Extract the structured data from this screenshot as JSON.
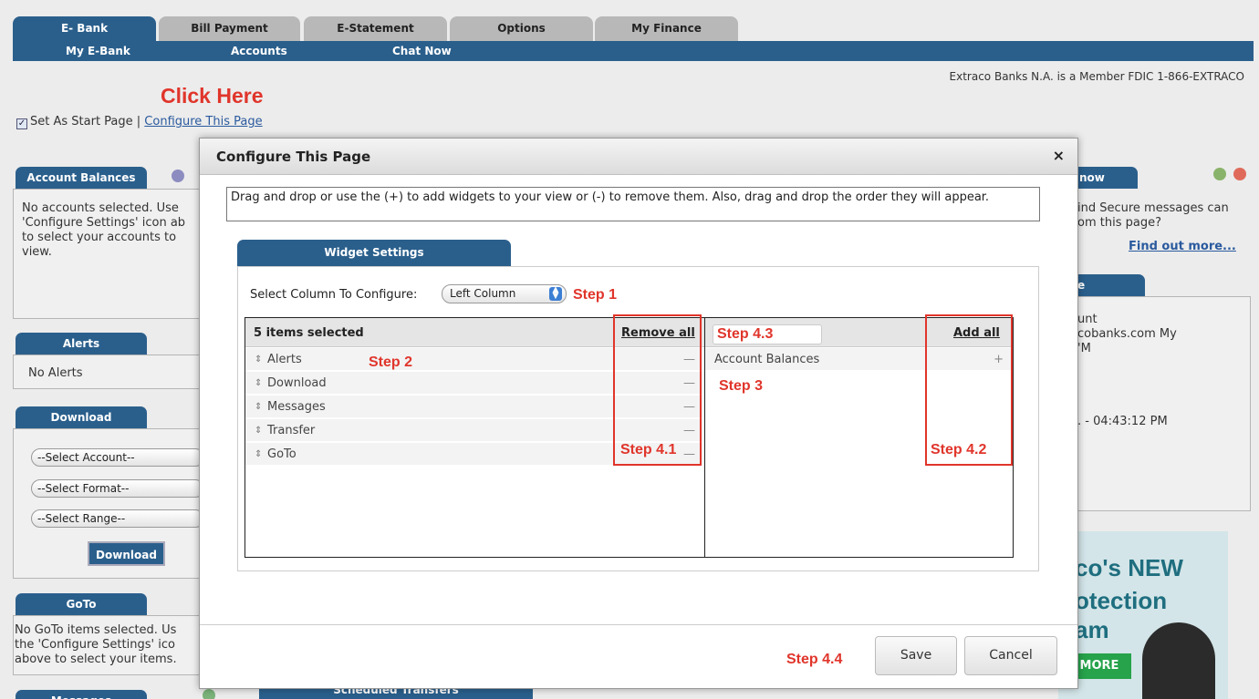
{
  "tabs": [
    {
      "label": "E- Bank",
      "active": true
    },
    {
      "label": "Bill Payment",
      "active": false
    },
    {
      "label": "E-Statement",
      "active": false
    },
    {
      "label": "Options",
      "active": false
    },
    {
      "label": "My Finance",
      "active": false
    }
  ],
  "subnav": [
    "My E-Bank",
    "Accounts",
    "Chat Now"
  ],
  "fdic_notice": "Extraco Banks N.A. is a Member FDIC 1-866-EXTRACO",
  "annotations": {
    "click_here": "Click Here",
    "step1": "Step 1",
    "step2": "Step 2",
    "step3": "Step 3",
    "step4_1": "Step 4.1",
    "step4_2": "Step 4.2",
    "step4_3": "Step 4.3",
    "step4_4": "Step 4.4"
  },
  "start_page": {
    "checkbox_checked": true,
    "label": "Set As Start Page |",
    "link": "Configure This Page"
  },
  "left_widgets": {
    "account_balances": {
      "title": "Account Balances",
      "text": [
        "No accounts selected. Use",
        "'Configure Settings' icon ab",
        "to select your accounts to",
        "view."
      ]
    },
    "alerts": {
      "title": "Alerts",
      "text": "No Alerts"
    },
    "download": {
      "title": "Download",
      "selects": [
        "--Select Account--",
        "--Select Format--",
        "--Select Range--"
      ],
      "button": "Download"
    },
    "goto": {
      "title": "GoTo",
      "text": [
        "No GoTo items selected. Us",
        "the 'Configure Settings' ico",
        "above to select your items."
      ]
    },
    "messages": {
      "title": "Messages"
    }
  },
  "right_widgets": {
    "chat": {
      "title": "now",
      "text": [
        "ind Secure messages can",
        "om this page?"
      ],
      "link": "Find out more..."
    },
    "info": {
      "title": "e",
      "text": [
        "unt",
        "cobanks.com My",
        "'M"
      ],
      "time": ". - 04:43:12 PM"
    },
    "promo": {
      "lines": [
        "co's NEW",
        "otection",
        "am"
      ],
      "button": "MORE"
    }
  },
  "bottom_partial": "Scheduled Transfers",
  "modal": {
    "title": "Configure This Page",
    "close_glyph": "×",
    "instructions": "Drag and drop or use the (+) to add widgets to your view or (-) to remove them. Also, drag and drop the order they will appear.",
    "tab": "Widget Settings",
    "column_label": "Select Column To Configure:",
    "column_value": "Left Column",
    "selected_header": "5 items selected",
    "remove_all": "Remove all",
    "add_all": "Add all",
    "selected_items": [
      {
        "label": "Alerts",
        "action": "—"
      },
      {
        "label": "Download",
        "action": "—"
      },
      {
        "label": "Messages",
        "action": "—"
      },
      {
        "label": "Transfer",
        "action": "—"
      },
      {
        "label": "GoTo",
        "action": "—"
      }
    ],
    "available_items": [
      {
        "label": "Account Balances",
        "action": "+"
      }
    ],
    "save": "Save",
    "cancel": "Cancel"
  },
  "colors": {
    "brand_blue": "#2a5f8c",
    "annotation_red": "#e0352b",
    "tab_inactive": "#b8b8b8"
  }
}
